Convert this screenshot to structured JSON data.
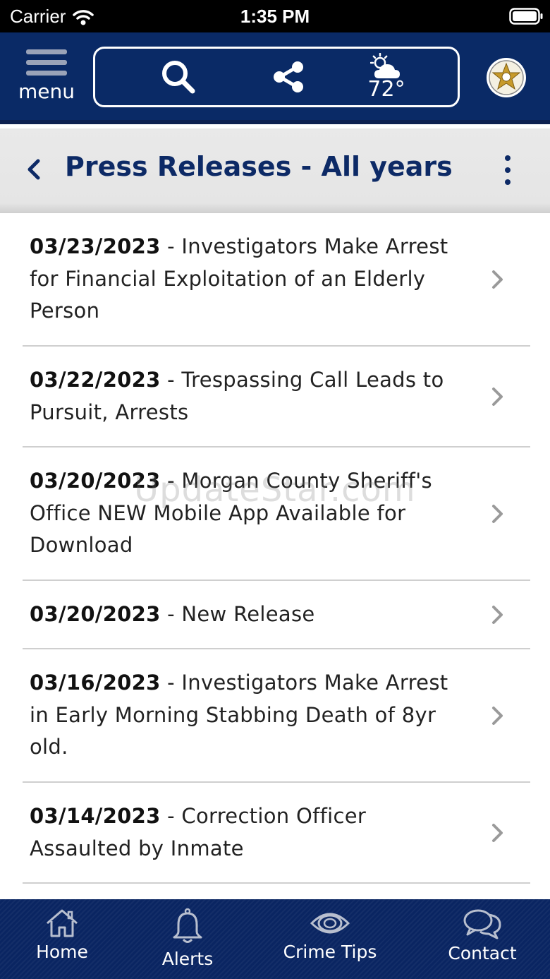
{
  "status_bar": {
    "carrier": "Carrier",
    "time": "1:35 PM"
  },
  "header": {
    "menu_label": "menu",
    "weather_temp": "72°",
    "icons": [
      "search-icon",
      "share-icon",
      "partly-cloudy-icon",
      "sheriff-badge-icon"
    ],
    "colors": {
      "primary": "#0a2a66",
      "accent": "#c79a2b"
    }
  },
  "title_bar": {
    "title": "Press Releases - All years"
  },
  "press_releases": [
    {
      "date": "03/23/2023",
      "title": " - Investigators Make Arrest for Financial Exploitation of an Elderly Person"
    },
    {
      "date": "03/22/2023",
      "title": " - Trespassing Call Leads to Pursuit, Arrests"
    },
    {
      "date": "03/20/2023",
      "title": " - Morgan County Sheriff's Office NEW Mobile App Available for Download"
    },
    {
      "date": "03/20/2023",
      "title": " - New Release"
    },
    {
      "date": "03/16/2023",
      "title": " - Investigators Make Arrest in Early Morning Stabbing Death of 8yr old."
    },
    {
      "date": "03/14/2023",
      "title": " - Correction Officer Assaulted by Inmate"
    }
  ],
  "watermark": "UpdateStar.com",
  "bottom_nav": {
    "home": "Home",
    "alerts": "Alerts",
    "crime_tips": "Crime Tips",
    "contact": "Contact"
  }
}
